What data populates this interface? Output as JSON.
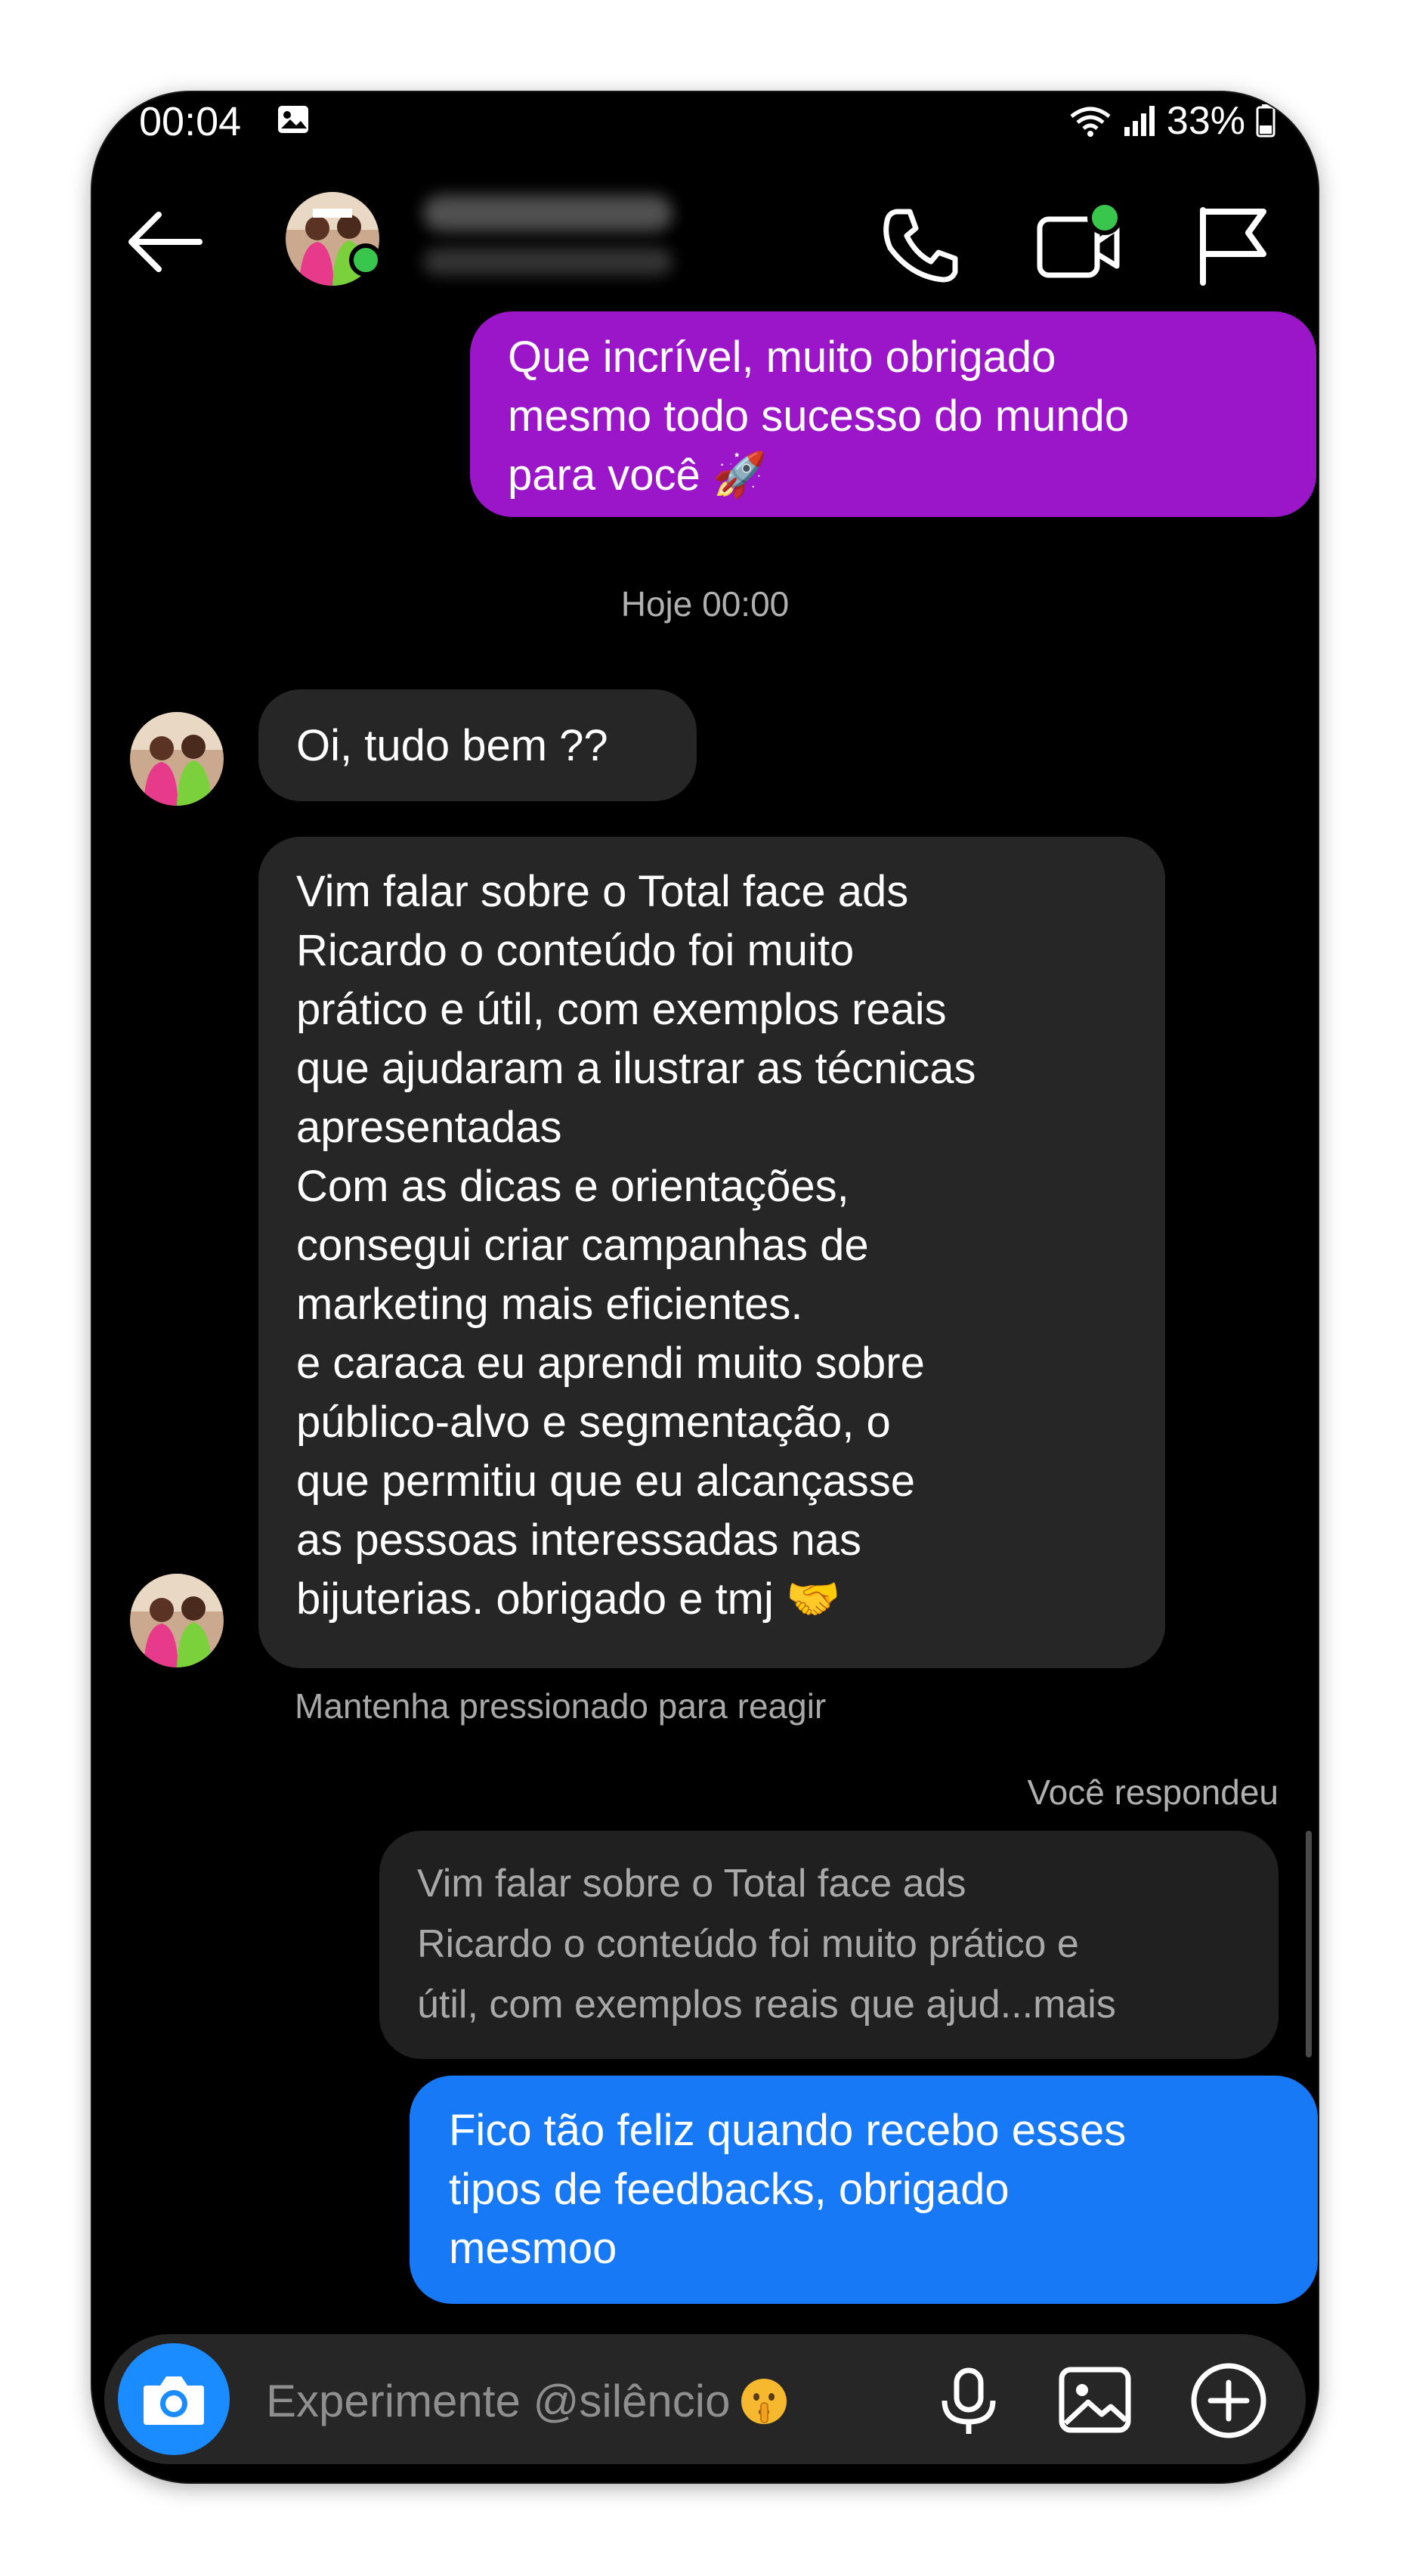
{
  "status_bar": {
    "time": "00:04",
    "battery": "33%",
    "icons": [
      "image-icon",
      "wifi-icon",
      "signal-icon",
      "battery-icon"
    ]
  },
  "header": {
    "icons": [
      "back-arrow-icon",
      "phone-icon",
      "video-call-icon",
      "flag-icon"
    ]
  },
  "messages": {
    "sent_1": "Que incrível, muito obrigado\nmesmo todo sucesso do mundo\npara você 🚀",
    "timestamp": "Hoje 00:00",
    "received_1": "Oi, tudo bem ??",
    "received_2": "Vim falar sobre o Total face ads\nRicardo o conteúdo foi muito\nprático e útil, com exemplos reais\nque ajudaram a ilustrar as técnicas\napresentadas\nCom as dicas e orientações,\nconsegui criar campanhas de\nmarketing mais eficientes.\ne caraca eu aprendi muito sobre\npúblico-alvo e segmentação, o\nque permitiu que eu alcançasse\nas pessoas interessadas nas\nbijuterias. obrigado e tmj 🤝",
    "react_hint": "Mantenha pressionado para reagir",
    "replied_label": "Você respondeu",
    "quoted": "Vim falar sobre o Total face ads\nRicardo o conteúdo foi muito prático e\nútil, com exemplos reais que ajud...mais",
    "sent_2": "Fico tão feliz quando recebo esses\ntipos de feedbacks, obrigado\nmesmoo"
  },
  "composer": {
    "placeholder": "Experimente @silêncio",
    "icons": [
      "camera-icon",
      "shush-emoji-icon",
      "microphone-icon",
      "gallery-icon",
      "add-circle-icon"
    ]
  },
  "colors": {
    "background": "#000000",
    "sent_purple": "#9b16c8",
    "sent_blue": "#1779f5",
    "received": "#262626",
    "online": "#39c64c",
    "camera_button": "#1a8cff"
  }
}
